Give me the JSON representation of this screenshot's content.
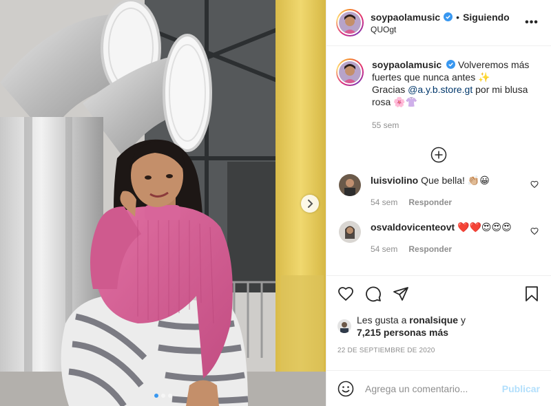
{
  "post": {
    "username": "soypaolamusic",
    "separator": "•",
    "follow_label": "Siguiendo",
    "location": "QUOgt",
    "more_label": "•••"
  },
  "caption": {
    "username": "soypaolamusic",
    "text_1": "Volveremos más fuertes que nunca antes ✨",
    "text_2": "Gracias ",
    "mention": "@a.y.b.store.gt",
    "text_3": " por mi blusa rosa 🌸👚",
    "time": "55 sem"
  },
  "comments": [
    {
      "username": "luisviolino",
      "text": "Que bella! 👏🏼😀",
      "time": "54 sem",
      "reply_label": "Responder"
    },
    {
      "username": "osvaldovicenteovt",
      "text": "❤️❤️😍😍😍",
      "time": "54 sem",
      "reply_label": "Responder"
    }
  ],
  "likes": {
    "prefix": "Les gusta a ",
    "user": "ronalsique",
    "middle": " y",
    "count_text": "7,215 personas más"
  },
  "date": "22 DE SEPTIEMBRE DE 2020",
  "add_comment": {
    "placeholder": "Agrega un comentario...",
    "publish_label": "Publicar"
  },
  "carousel": {
    "count": 3,
    "active_index": 0
  },
  "colors": {
    "accent": "#3897f0",
    "verified": "#3897f0",
    "publish_disabled": "#b2dffc",
    "sweater": "#d85c93",
    "pillar": "#e8cc5c"
  }
}
